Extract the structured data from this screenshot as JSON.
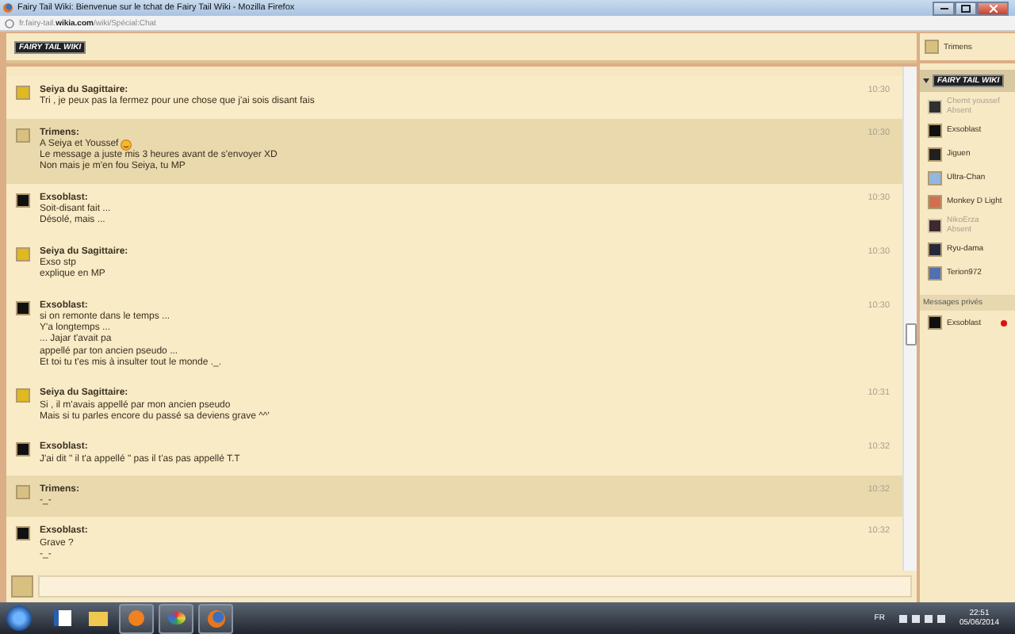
{
  "window": {
    "title": "Fairy Tail Wiki: Bienvenue sur le tchat de Fairy Tail Wiki - Mozilla Firefox",
    "address": "fr.fairy-tail.**wikia.com**/wiki/Spécial:Chat"
  },
  "chat": {
    "logo": "FAIRY TAIL WIKI",
    "messages": [
      {
        "author": "Seiya du Sagittaire:",
        "color": "#e0b820",
        "highlighted": false,
        "time": "10:30",
        "lines": [
          "Tri , je peux pas la fermez pour une chose que j'ai sois disant fais"
        ]
      },
      {
        "author": "Trimens:",
        "color": "#d8c080",
        "highlighted": true,
        "time": "10:30",
        "lines": [
          {
            "text": "A Seiya et Youssef",
            "smiley": true
          },
          "Le message a juste mis 3 heures avant de s'envoyer XD",
          "Non mais je m'en fou Seiya, tu MP"
        ]
      },
      {
        "author": "Exsoblast:",
        "color": "#101010",
        "highlighted": false,
        "time": "10:30",
        "lines": [
          "Soit-disant fait ...",
          "Désolé, mais ..."
        ]
      },
      {
        "author": "Seiya du Sagittaire:",
        "color": "#e0b820",
        "highlighted": false,
        "time": "10:30",
        "lines": [
          "Exso stp",
          "explique en MP"
        ]
      },
      {
        "author": "Exsoblast:",
        "color": "#101010",
        "highlighted": false,
        "time": "10:30",
        "lines": [
          "si on remonte dans le temps ...",
          "Y'a longtemps ...",
          "... Jajar t'avait pa",
          "appellé par ton ancien pseudo ...",
          "Et toi tu t'es mis à insulter tout le monde ._."
        ]
      },
      {
        "author": "Seiya du Sagittaire:",
        "color": "#e0b820",
        "highlighted": false,
        "time": "10:31",
        "lines": [
          "Si , il m'avais appellé par mon ancien pseudo",
          "Mais si tu parles encore du passé sa deviens grave ^^'"
        ]
      },
      {
        "author": "Exsoblast:",
        "color": "#101010",
        "highlighted": false,
        "time": "10:32",
        "lines": [
          "J'ai dit \" il t'a appellé \" pas il t'as pas appellé T.T"
        ]
      },
      {
        "author": "Trimens:",
        "color": "#d8c080",
        "highlighted": true,
        "time": "10:32",
        "lines": [
          "-_-"
        ]
      },
      {
        "author": "Exsoblast:",
        "color": "#101010",
        "highlighted": false,
        "time": "10:32",
        "lines": [
          "Grave ?",
          "-_-"
        ]
      }
    ]
  },
  "sidebar": {
    "me": {
      "name": "Trimens",
      "color": "#d8c080"
    },
    "room": "FAIRY TAIL WIKI",
    "users": [
      {
        "name": "Chemt youssef",
        "status": "Absent",
        "away": true,
        "color": "#303030"
      },
      {
        "name": "Exsoblast",
        "away": false,
        "color": "#101010"
      },
      {
        "name": "Jiguen",
        "away": false,
        "color": "#202020"
      },
      {
        "name": "Ultra-Chan",
        "away": false,
        "color": "#90b8e0"
      },
      {
        "name": "Monkey D Light",
        "away": false,
        "color": "#d07050"
      },
      {
        "name": "NikoErza",
        "status": "Absent",
        "away": true,
        "color": "#402830"
      },
      {
        "name": "Ryu-dama",
        "away": false,
        "color": "#282838"
      },
      {
        "name": "Terion972",
        "away": false,
        "color": "#5070b0"
      }
    ],
    "private_header": "Messages privés",
    "private": [
      {
        "name": "Exsoblast",
        "color": "#101010",
        "unread": true
      }
    ]
  },
  "taskbar": {
    "language": "FR",
    "time": "22:51",
    "date": "05/06/2014"
  }
}
